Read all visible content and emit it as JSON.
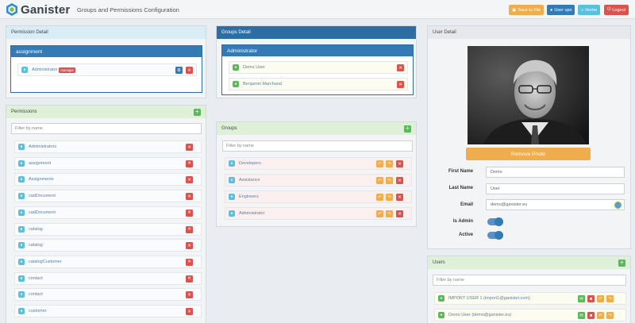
{
  "app": {
    "name": "Ganister",
    "page_title": "Groups and Permissions Configuration"
  },
  "toolbar": {
    "save_label": "Save to File",
    "userups_label": "User ups",
    "home_label": "Home",
    "logout_label": "Logout"
  },
  "permission_detail": {
    "title": "Permission Detail",
    "sub_title": "assignment",
    "item_label": "Administrator",
    "item_badge": "manager"
  },
  "groups_detail": {
    "title": "Groups Detail",
    "sub_title": "Administrator",
    "users": [
      "Demo User",
      "Benjamin Marchand"
    ]
  },
  "permissions": {
    "title": "Permissions",
    "filter_placeholder": "Filter by name",
    "items": [
      "Administrators",
      "assignment",
      "Assignments",
      "cadDocument",
      "cadDocument",
      "catalog",
      "catalog",
      "catalogCustomer",
      "contact",
      "contact",
      "customer"
    ]
  },
  "groups": {
    "title": "Groups",
    "filter_placeholder": "Filter by name",
    "items": [
      "Developers",
      "Assistance",
      "Engineers",
      "Administrator"
    ]
  },
  "user_detail": {
    "title": "User Detail",
    "remove_photo_label": "Remove Photo",
    "first_name_label": "First Name",
    "first_name": "Demo",
    "last_name_label": "Last Name",
    "last_name": "User",
    "email_label": "Email",
    "email": "demo@ganister.eu",
    "is_admin_label": "Is Admin",
    "is_admin": true,
    "active_label": "Active",
    "active": true
  },
  "users": {
    "title": "Users",
    "filter_placeholder": "Filter by name",
    "items": [
      "IMPORT USER 1 (import1@ganister.com)",
      "Demo User (demo@ganister.eu)"
    ]
  },
  "colors": {
    "primary": "#337ab7",
    "success": "#5cb85c",
    "danger": "#d9534f",
    "warning": "#f0ad4e",
    "info": "#5bc0de"
  }
}
